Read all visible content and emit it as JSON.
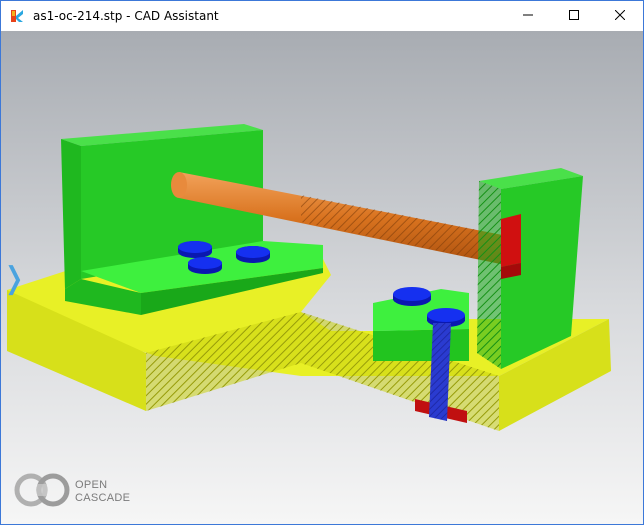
{
  "window": {
    "title": "as1-oc-214.stp - CAD Assistant",
    "controls": {
      "minimize_icon": "minimize-icon",
      "maximize_icon": "maximize-icon",
      "close_icon": "close-icon"
    }
  },
  "viewport": {
    "background_top": "#a8acb2",
    "background_bottom": "#f6f6f6",
    "side_panel_toggle": "❭",
    "branding": {
      "line1": "OPEN",
      "line2": "CASCADE"
    }
  },
  "model_colors": {
    "base_plate": "#e6f01e",
    "brackets": "#22c41f",
    "rod": "#d2691e",
    "nuts": "#0a1ee0",
    "bolt": "#1e2aa8",
    "clips": "#d01010"
  }
}
